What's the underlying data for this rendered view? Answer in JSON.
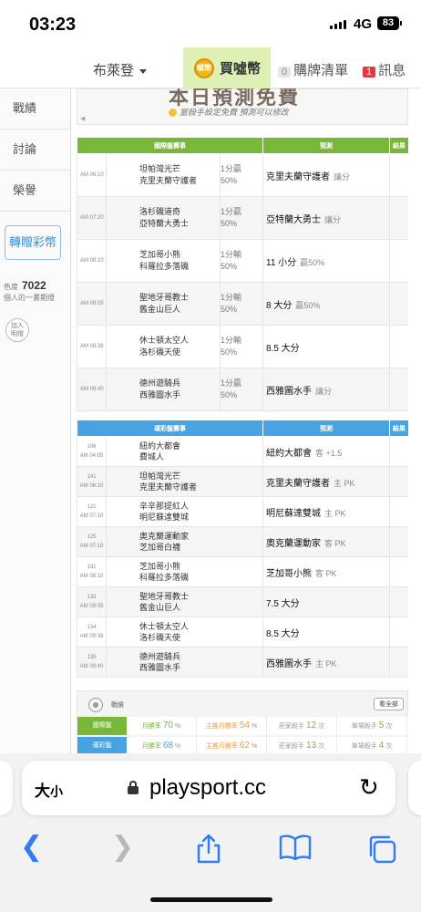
{
  "status_bar": {
    "time": "03:23",
    "network": "4G",
    "battery": "83"
  },
  "nav": {
    "brand": "布萊登",
    "buy_label": "買噓幣",
    "coin_text": "噓幣",
    "cart_count": "0",
    "cart_label": "購牌清單",
    "msg_count": "1",
    "msg_label": "訊息"
  },
  "sidebar": {
    "items": [
      {
        "label": "戰績"
      },
      {
        "label": "討論"
      },
      {
        "label": "榮譽"
      }
    ],
    "gift_label": "轉贈彩幣",
    "stat_prefix": "色度",
    "stat_value": "7022",
    "stat_suffix": "個人的一書期燈",
    "add_label": "加入",
    "add_label2": "明燈"
  },
  "banner": {
    "title": "本日預測免費",
    "subtitle": "當殺手設定免費  預測可以修改"
  },
  "intl_table": {
    "headers": {
      "game": "國際盤賽事",
      "pick": "預測",
      "result": "結果"
    },
    "rows": [
      {
        "time": "AM 06:10",
        "team1": "坦帕灣光芒",
        "team2": "克里夫蘭守護者",
        "odds1": "1分贏",
        "odds2": "50%",
        "pick": "克里夫蘭守護者",
        "pick_type": "讓分"
      },
      {
        "time": "AM 07:20",
        "team1": "洛杉磯道奇",
        "team2": "亞特蘭大勇士",
        "odds1": "1分贏",
        "odds2": "50%",
        "pick": "亞特蘭大勇士",
        "pick_type": "讓分"
      },
      {
        "time": "AM 08:10",
        "team1": "芝加哥小熊",
        "team2": "科羅拉多落磯",
        "odds1": "1分輸",
        "odds2": "50%",
        "pick": "11 小分",
        "pick_type": "贏50%"
      },
      {
        "time": "AM 09:05",
        "team1": "聖地牙哥教士",
        "team2": "舊金山巨人",
        "odds1": "1分輸",
        "odds2": "50%",
        "pick": "8 大分",
        "pick_type": "贏50%"
      },
      {
        "time": "AM 09:38",
        "team1": "休士頓太空人",
        "team2": "洛杉磯天使",
        "odds1": "1分輸",
        "odds2": "50%",
        "pick": "8.5 大分",
        "pick_type": ""
      },
      {
        "time": "AM 09:40",
        "team1": "德州遊騎兵",
        "team2": "西雅圖水手",
        "odds1": "1分贏",
        "odds2": "50%",
        "pick": "西雅圖水手",
        "pick_type": "讓分"
      }
    ]
  },
  "local_table": {
    "headers": {
      "game": "運彩盤賽事",
      "pick": "預測",
      "result": "結果"
    },
    "rows": [
      {
        "num": "106",
        "time": "AM 04:05",
        "team1": "紐約大都會",
        "team2": "費城人",
        "pick": "紐約大都會",
        "pick_type": "客 +1.5"
      },
      {
        "num": "141",
        "time": "AM 06:10",
        "team1": "坦帕灣光芒",
        "team2": "克里夫蘭守護者",
        "pick": "克里夫蘭守護者",
        "pick_type": "主 PK"
      },
      {
        "num": "121",
        "time": "AM 07:10",
        "team1": "辛辛那提紅人",
        "team2": "明尼蘇達雙城",
        "pick": "明尼蘇達雙城",
        "pick_type": "主 PK"
      },
      {
        "num": "125",
        "time": "AM 07:10",
        "team1": "奧克蘭運動家",
        "team2": "芝加哥白襪",
        "pick": "奧克蘭運動家",
        "pick_type": "客 PK"
      },
      {
        "num": "131",
        "time": "AM 08:10",
        "team1": "芝加哥小熊",
        "team2": "科羅拉多落磯",
        "pick": "芝加哥小熊",
        "pick_type": "客 PK"
      },
      {
        "num": "133",
        "time": "AM 09:05",
        "team1": "聖地牙哥教士",
        "team2": "舊金山巨人",
        "pick": "7.5 大分",
        "pick_type": ""
      },
      {
        "num": "134",
        "time": "AM 09:38",
        "team1": "休士頓太空人",
        "team2": "洛杉磯天使",
        "pick": "8.5 大分",
        "pick_type": ""
      },
      {
        "num": "135",
        "time": "AM 09:40",
        "team1": "德州遊騎兵",
        "team2": "西雅圖水手",
        "pick": "西雅圖水手",
        "pick_type": "主 PK"
      }
    ]
  },
  "record": {
    "title": "戰績",
    "view_all": "看全部",
    "rows": [
      {
        "tag": "國際盤",
        "c1_label": "月勝率",
        "c1_val": "70",
        "c1_unit": "%",
        "c2_label": "主推月勝率",
        "c2_val": "54",
        "c2_unit": "%",
        "c3_label": "莊家殺手",
        "c3_val": "12",
        "c3_unit": "次",
        "c4_label": "單場殺手",
        "c4_val": "5",
        "c4_unit": "次"
      },
      {
        "tag": "運彩盤",
        "c1_label": "月勝率",
        "c1_val": "68",
        "c1_unit": "%",
        "c2_label": "主推月勝率",
        "c2_val": "62",
        "c2_unit": "%",
        "c3_label": "莊家殺手",
        "c3_val": "13",
        "c3_unit": "次",
        "c4_label": "單場殺手",
        "c4_val": "4",
        "c4_unit": "次"
      }
    ]
  },
  "safari": {
    "text_size": "大",
    "text_size_small": "小",
    "domain": "playsport.cc"
  }
}
